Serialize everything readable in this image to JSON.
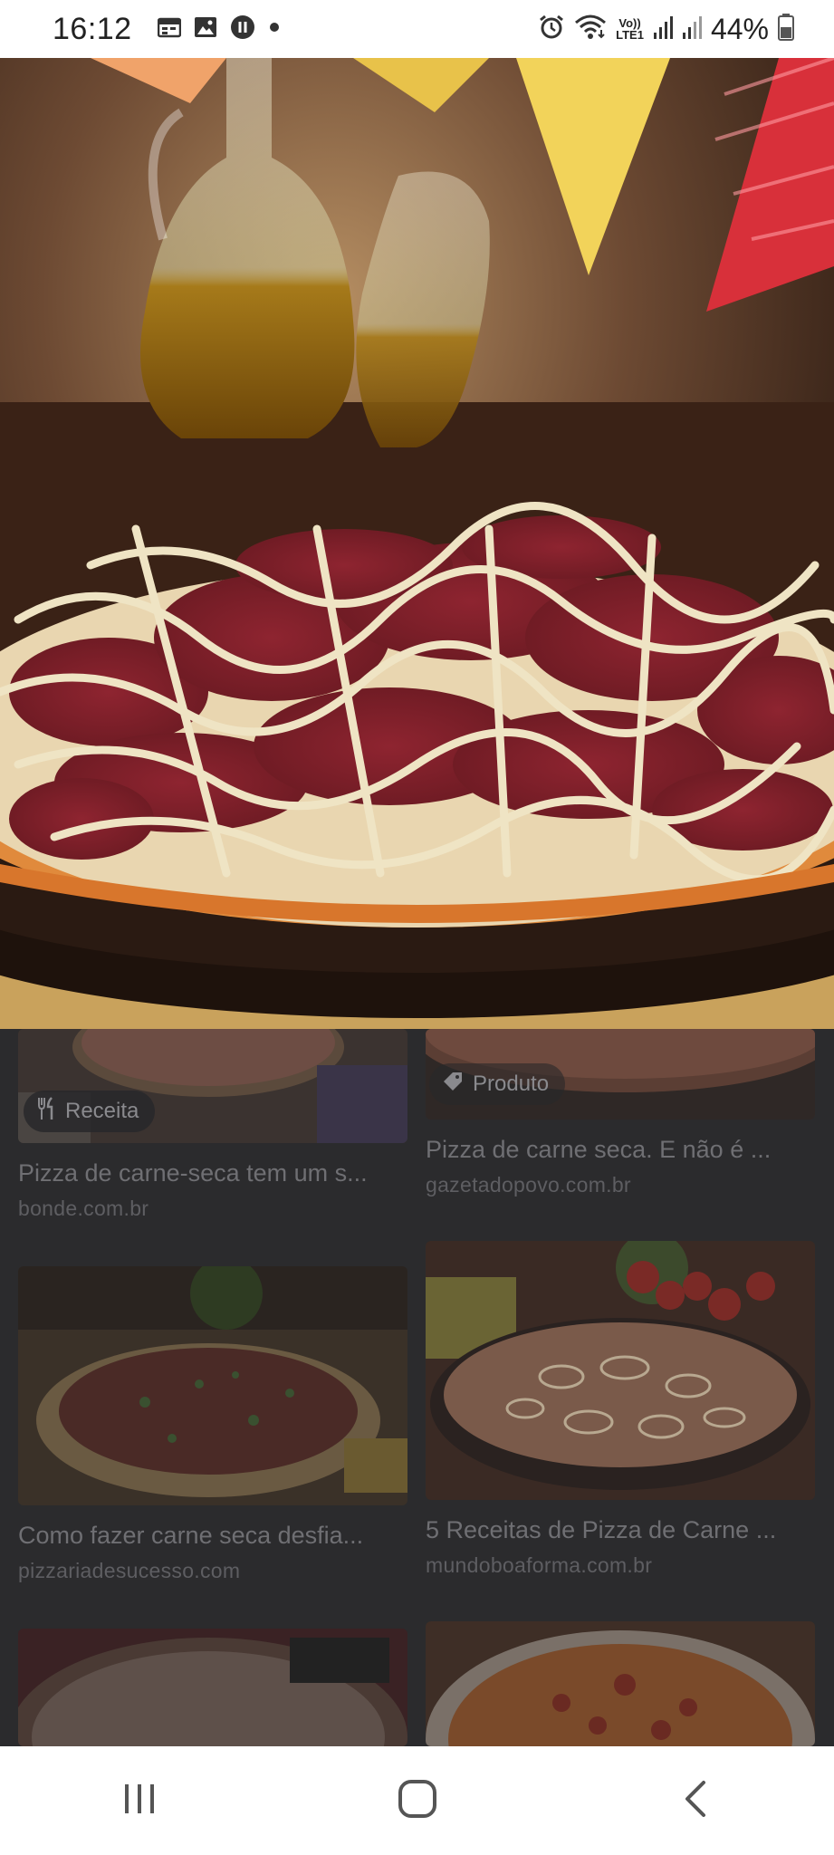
{
  "status_bar": {
    "time": "16:12",
    "battery_percent": "44%",
    "network": "LTE1",
    "volte": "Vo))",
    "left_icons": [
      "calendar-icon",
      "image-icon",
      "shazam-icon",
      "dot-icon"
    ],
    "right_icons": [
      "alarm-icon",
      "wifi-icon",
      "signal-icon",
      "signal-icon",
      "battery-icon"
    ]
  },
  "hero": {
    "description_icon": "pizza-image"
  },
  "results": [
    {
      "title": "Pizza de carne-seca tem um s...",
      "source": "bonde.com.br",
      "chip": "Receita",
      "chip_icon": "fork-knife-icon"
    },
    {
      "title": "Pizza de carne seca. E não é ...",
      "source": "gazetadopovo.com.br",
      "chip": "Produto",
      "chip_icon": "tag-icon"
    },
    {
      "title": "Como fazer carne seca desfia...",
      "source": "pizzariadesucesso.com"
    },
    {
      "title": "5 Receitas de Pizza de Carne ...",
      "source": "mundoboaforma.com.br"
    }
  ],
  "nav": {
    "recent_icon": "recent-apps-icon",
    "home_icon": "home-icon",
    "back_icon": "back-icon"
  }
}
